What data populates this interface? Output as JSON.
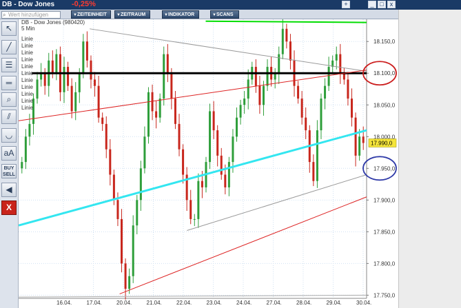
{
  "window": {
    "title": "DB - Dow Jones",
    "change": "-0,25%",
    "buttons": {
      "pin": "+",
      "minimize": "_",
      "maximize": "□",
      "close": "x"
    }
  },
  "toolbar": {
    "search_placeholder": "Wert hinzufügen",
    "menus": [
      "ZEITEINHEIT",
      "ZEITRAUM",
      "INDIKATOR",
      "SCANS"
    ]
  },
  "tools": [
    {
      "name": "cursor-tool",
      "label": "↖"
    },
    {
      "name": "line-tool",
      "label": "╱"
    },
    {
      "name": "fibonacci-tool",
      "label": "☰"
    },
    {
      "name": "horizontal-line-tool",
      "label": "═"
    },
    {
      "name": "zoom-tool",
      "label": "⌕"
    },
    {
      "name": "channel-tool",
      "label": "⫽"
    },
    {
      "name": "hand-tool",
      "label": "✋"
    },
    {
      "name": "curve-tool",
      "label": "◡"
    },
    {
      "name": "text-tool",
      "label": "aA"
    },
    {
      "name": "buy-sell-tool",
      "label1": "BUY",
      "label2": "SELL"
    },
    {
      "name": "sound-tool",
      "label": "◀"
    },
    {
      "name": "delete-tool",
      "label": "X"
    }
  ],
  "chart_data": {
    "type": "candlestick",
    "title": "DB - Dow Jones (980420)",
    "period": "5 Min",
    "legend": [
      "Linie",
      "Linie",
      "Linie",
      "Linie",
      "Linie",
      "Linie",
      "Linie",
      "Linie",
      "Linie",
      "Linie",
      "Linie"
    ],
    "x_ticks": [
      "16.04.",
      "17.04.",
      "20.04.",
      "21.04.",
      "22.04.",
      "23.04.",
      "24.04.",
      "27.04.",
      "28.04.",
      "29.04.",
      "30.04."
    ],
    "y_ticks": [
      "18.150,0",
      "18.100,0",
      "18.050,0",
      "18.000,0",
      "17.950,0",
      "17.900,0",
      "17.850,0",
      "17.800,0",
      "17.750,0"
    ],
    "ylim": [
      17745,
      18185
    ],
    "y_axis_position": "right",
    "grid": true,
    "current_price_label": "17.990,0",
    "current_price": 17990,
    "series_close": [
      17960,
      18000,
      18020,
      18060,
      18090,
      18100,
      18080,
      18120,
      18100,
      18130,
      18070,
      18110,
      18080,
      18040,
      18070,
      18100,
      18150,
      18120,
      18090,
      18080,
      18030,
      18020,
      17980,
      17940,
      17900,
      17870,
      17800,
      17760,
      17780,
      17860,
      17900,
      17950,
      18000,
      18070,
      18040,
      18030,
      18060,
      18130,
      18100,
      18060,
      18020,
      17980,
      17940,
      17900,
      17870,
      17870,
      17930,
      17920,
      17960,
      18040,
      18010,
      17970,
      17940,
      17920,
      17960,
      18000,
      18030,
      18050,
      18060,
      18090,
      18110,
      18080,
      18050,
      18080,
      18110,
      18090,
      18100,
      18130,
      18170,
      18150,
      18120,
      18080,
      18060,
      18030,
      18010,
      17960,
      17930,
      18010,
      18060,
      18080,
      18110,
      18120,
      18130,
      18100,
      18090,
      18060,
      18030,
      17970,
      18000,
      17990
    ],
    "lines": [
      {
        "name": "resistance-line",
        "color": "#000000",
        "from": [
          0.035,
          18100
        ],
        "to": [
          0.93,
          18100
        ]
      },
      {
        "name": "upper-green-line",
        "color": "#00dd00",
        "from": [
          0.5,
          18182
        ],
        "to": [
          0.93,
          18180
        ]
      },
      {
        "name": "cyan-trendline",
        "color": "#33e6f0",
        "from": [
          0.0,
          17860
        ],
        "to": [
          0.93,
          18010
        ]
      },
      {
        "name": "gray-upper-channel",
        "color": "#999999",
        "from": [
          0.19,
          18170
        ],
        "to": [
          0.93,
          18103
        ]
      },
      {
        "name": "gray-lower-channel",
        "color": "#999999",
        "from": [
          0.45,
          17852
        ],
        "to": [
          0.93,
          17940
        ]
      },
      {
        "name": "red-upper-trendline",
        "color": "#dd2222",
        "from": [
          0.0,
          18025
        ],
        "to": [
          0.93,
          18105
        ]
      },
      {
        "name": "red-lower-trendline",
        "color": "#dd2222",
        "from": [
          0.27,
          17752
        ],
        "to": [
          0.93,
          17905
        ]
      },
      {
        "name": "bottom-gray-line",
        "color": "#aaaaaa",
        "from": [
          0.0,
          17747
        ],
        "to": [
          0.93,
          17750
        ]
      }
    ],
    "annotations": [
      {
        "name": "red-ellipse-resistance",
        "color": "#cc1f1f",
        "center": [
          0.965,
          18100
        ]
      },
      {
        "name": "blue-ellipse-support",
        "color": "#2f3aa8",
        "center": [
          0.965,
          17950
        ]
      }
    ]
  },
  "colors": {
    "up_candle": "#2e9e3a",
    "down_candle": "#c8261c",
    "grid": "#cfe0f2",
    "title_bar": "#1a3a66",
    "toolbar_button": "#2f4a6e"
  }
}
